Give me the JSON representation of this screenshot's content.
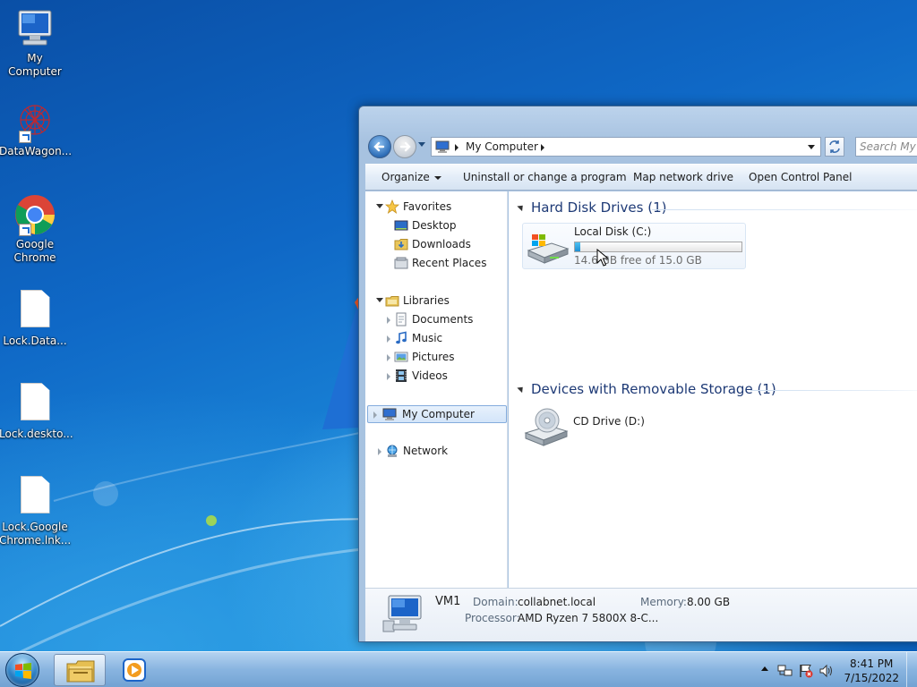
{
  "desktop": {
    "icons": [
      {
        "label": "My Computer",
        "icon": "computer-icon"
      },
      {
        "label": "DataWagon...",
        "icon": "datawagon-icon"
      },
      {
        "label": "Google Chrome",
        "icon": "chrome-icon"
      },
      {
        "label": "Lock.Data...",
        "icon": "file-icon"
      },
      {
        "label": "Lock.deskto...",
        "icon": "file-icon"
      },
      {
        "label": "Lock.Google Chrome.lnk...",
        "icon": "file-icon"
      }
    ]
  },
  "explorer": {
    "address": {
      "crumb": "My Computer",
      "search_placeholder": "Search My Computer"
    },
    "toolbar": {
      "organize": "Organize",
      "uninstall": "Uninstall or change a program",
      "map_drive": "Map network drive",
      "control_panel": "Open Control Panel"
    },
    "nav": {
      "favorites": "Favorites",
      "desktop": "Desktop",
      "downloads": "Downloads",
      "recent": "Recent Places",
      "libraries": "Libraries",
      "documents": "Documents",
      "music": "Music",
      "pictures": "Pictures",
      "videos": "Videos",
      "computer": "My Computer",
      "network": "Network"
    },
    "content": {
      "hdd_header": "Hard Disk Drives (1)",
      "removable_header": "Devices with Removable Storage (1)",
      "local_disk": {
        "name": "Local Disk (C:)",
        "free_text": "14.6 GB free of 15.0 GB",
        "usage_fraction": 0.03
      },
      "cd_drive": "CD Drive (D:)"
    },
    "status": {
      "computer_name": "VM1",
      "domain_label": "Domain:",
      "domain_value": "collabnet.local",
      "memory_label": "Memory:",
      "memory_value": "8.00 GB",
      "processor_label": "Processor:",
      "processor_value": "AMD Ryzen 7 5800X 8-C..."
    }
  },
  "taskbar": {
    "clock_time": "8:41 PM",
    "clock_date": "7/15/2022",
    "pinned": [
      "windows-explorer-icon",
      "media-player-icon"
    ]
  },
  "colors": {
    "wallpaper_blue": "#0f68c6",
    "selection": "#d3e5f9",
    "link_blue": "#1e3a76"
  }
}
